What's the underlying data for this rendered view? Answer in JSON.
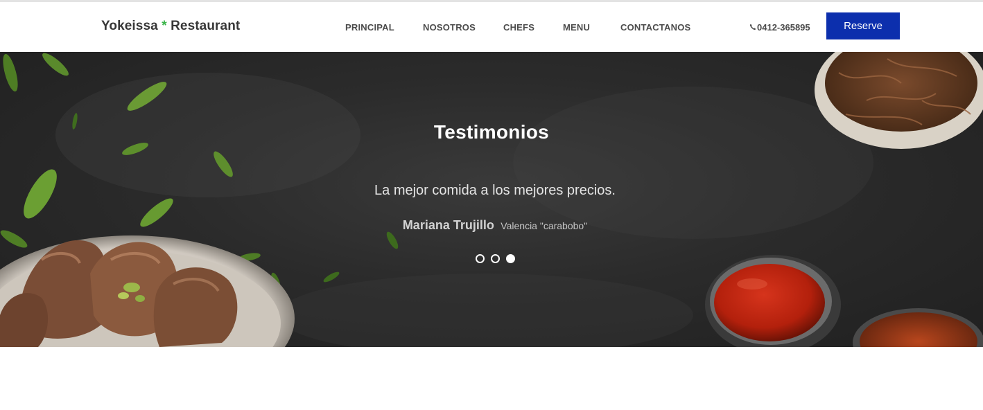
{
  "brand": {
    "name_part1": "Yokeissa",
    "separator": "*",
    "name_part2": "Restaurant",
    "separator_color": "#3bb54a"
  },
  "nav": {
    "items": [
      {
        "label": "PRINCIPAL"
      },
      {
        "label": "NOSOTROS"
      },
      {
        "label": "CHEFS"
      },
      {
        "label": "MENU"
      },
      {
        "label": "CONTACTANOS"
      }
    ]
  },
  "contact": {
    "phone_icon": "phone-icon",
    "phone": "0412-365895"
  },
  "reserve_button": {
    "label": "Reserve",
    "color": "#0c2fad"
  },
  "testimonials": {
    "title": "Testimonios",
    "quote": "La mejor comida a los mejores precios.",
    "author_name": "Mariana Trujillo",
    "author_place": "Valencia \"carabobo\"",
    "slide_count": 3,
    "active_slide": 3
  }
}
